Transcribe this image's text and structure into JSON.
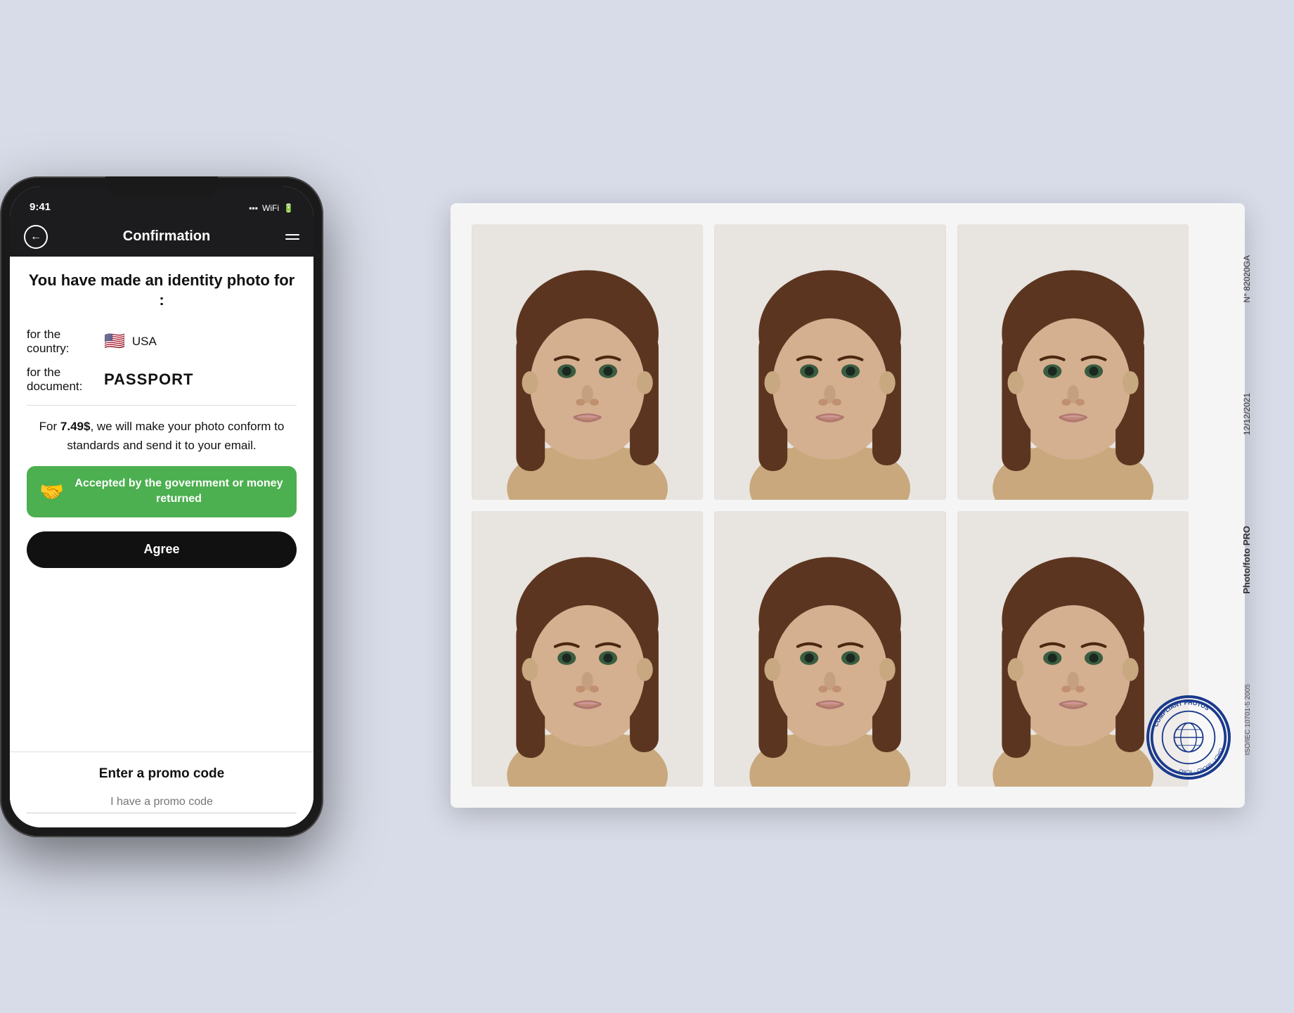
{
  "page": {
    "background_color": "#d8dce8"
  },
  "phone": {
    "status_time": "9:41",
    "nav_title": "Confirmation",
    "nav_back_icon": "←",
    "nav_menu_icon": "≡"
  },
  "screen": {
    "identity_title": "You have made an identity photo for :",
    "country_label": "for the country:",
    "country_flag": "🇺🇸",
    "country_name": "USA",
    "document_label": "for the document:",
    "document_name": "PASSPORT",
    "price_text_prefix": "For ",
    "price_value": "7.49$",
    "price_text_suffix": ", we will make your photo conform to standards and send it to your email.",
    "guarantee_text": "Accepted by the government or money returned",
    "agree_button": "Agree",
    "promo_title": "Enter a promo code",
    "promo_placeholder": "I have a promo code"
  },
  "photo_sheet": {
    "id_number": "N° 82020GA",
    "date": "12/12/2021",
    "photo_label": "Photo/foto PRO",
    "iso_label": "ISO/IEC 10701-5 2005",
    "stamp_text": "COMPLIANT PHOTOS",
    "stamp_subtext": "OACI MKAO"
  }
}
